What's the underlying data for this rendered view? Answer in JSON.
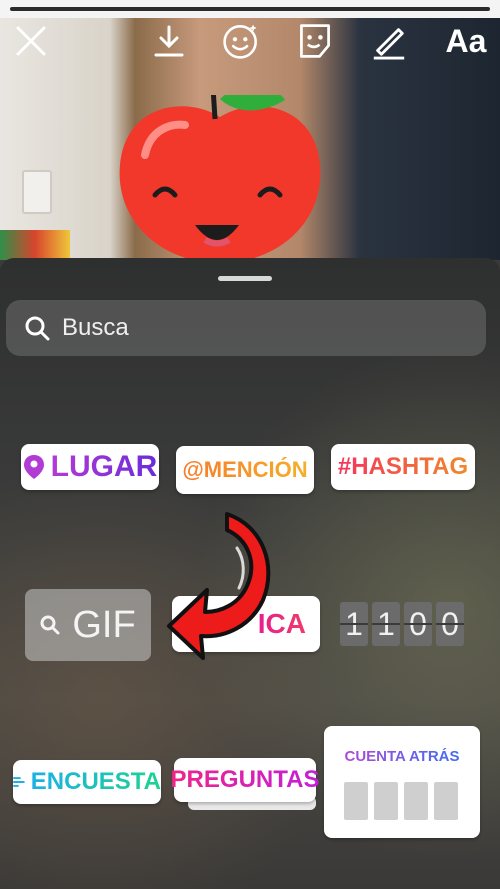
{
  "toolbar": {
    "close_icon": "close-icon",
    "download_icon": "download-icon",
    "face_effects_icon": "face-effects-icon",
    "sticker_icon": "sticker-icon",
    "draw_icon": "pen-icon",
    "text_label": "Aa"
  },
  "search": {
    "placeholder": "Busca"
  },
  "stickers": {
    "lugar": "LUGAR",
    "mencion": "@MENCIÓN",
    "hashtag": "#HASHTAG",
    "gif": "GIF",
    "musica": "ICA",
    "time_digits": [
      "1",
      "1",
      "0",
      "0"
    ],
    "encuesta": "ENCUESTA",
    "preguntas": "PREGUNTAS",
    "cuenta_atras": "CUENTA ATRÁS"
  },
  "colors": {
    "arrow_red": "#ee1b1b",
    "apple_red": "#f2382b",
    "leaf_green": "#2fae3c"
  }
}
